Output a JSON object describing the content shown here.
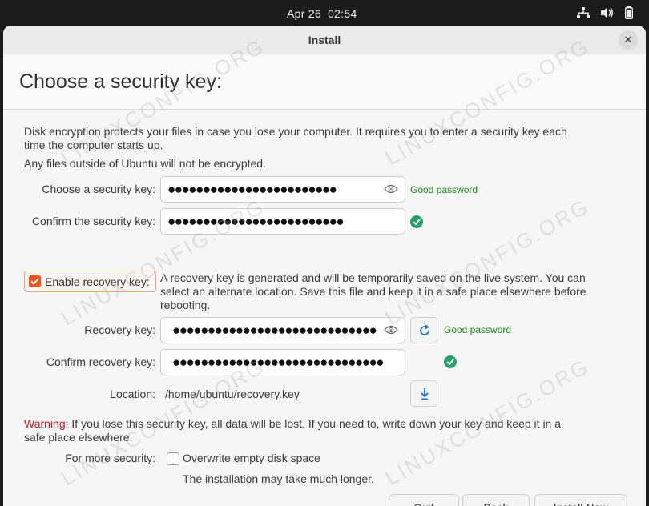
{
  "system_bar": {
    "date": "Apr 26",
    "time": "02:54",
    "icons": [
      "network-icon",
      "volume-icon",
      "battery-icon"
    ]
  },
  "window": {
    "title": "Install",
    "close_symbol": "✕"
  },
  "page": {
    "heading": "Choose a security key:",
    "intro_line1": "Disk encryption protects your files in case you lose your computer. It requires you to enter a security key each",
    "intro_line2": "time the computer starts up.",
    "intro_line3": "Any files outside of Ubuntu will not be encrypted."
  },
  "form": {
    "security_key_label": "Choose a security key:",
    "security_key_value": "●●●●●●●●●●●●●●●●●●●●●●●●",
    "security_key_strength": "Good password",
    "confirm_key_label": "Confirm the security key:",
    "confirm_key_value": "●●●●●●●●●●●●●●●●●●●●●●●●●",
    "recovery_checkbox_label": "Enable recovery key:",
    "recovery_checked": true,
    "recovery_desc_line1": "A recovery key is generated and will be temporarily saved on the live system. You can",
    "recovery_desc_line2": "select an alternate location. Save this file and keep it in a safe place elsewhere before",
    "recovery_desc_line3": "rebooting.",
    "recovery_key_label": "Recovery key:",
    "recovery_key_value": "●●●●●●●●●●●●●●●●●●●●●●●●●●●●●",
    "recovery_key_strength": "Good password",
    "confirm_recovery_label": "Confirm recovery key:",
    "confirm_recovery_value": "●●●●●●●●●●●●●●●●●●●●●●●●●●●●●●",
    "location_label": "Location:",
    "location_value": "/home/ubuntu/recovery.key",
    "warning_prefix": "Warning:",
    "warning_line1": " If you lose this security key, all data will be lost. If you need to, write down your key and keep it in a",
    "warning_line2": "safe place elsewhere.",
    "more_security_label": "For more security:",
    "overwrite_label": "Overwrite empty disk space",
    "overwrite_checked": false,
    "overwrite_note": "The installation may take much longer."
  },
  "buttons": {
    "quit": "Quit",
    "back": "Back",
    "install_now": "Install Now"
  },
  "watermark": "LINUXCONFIG.ORG",
  "colors": {
    "accent": "#e95420",
    "success": "#26a269",
    "warning": "#c01c28",
    "good_text": "#1e8e1e"
  }
}
